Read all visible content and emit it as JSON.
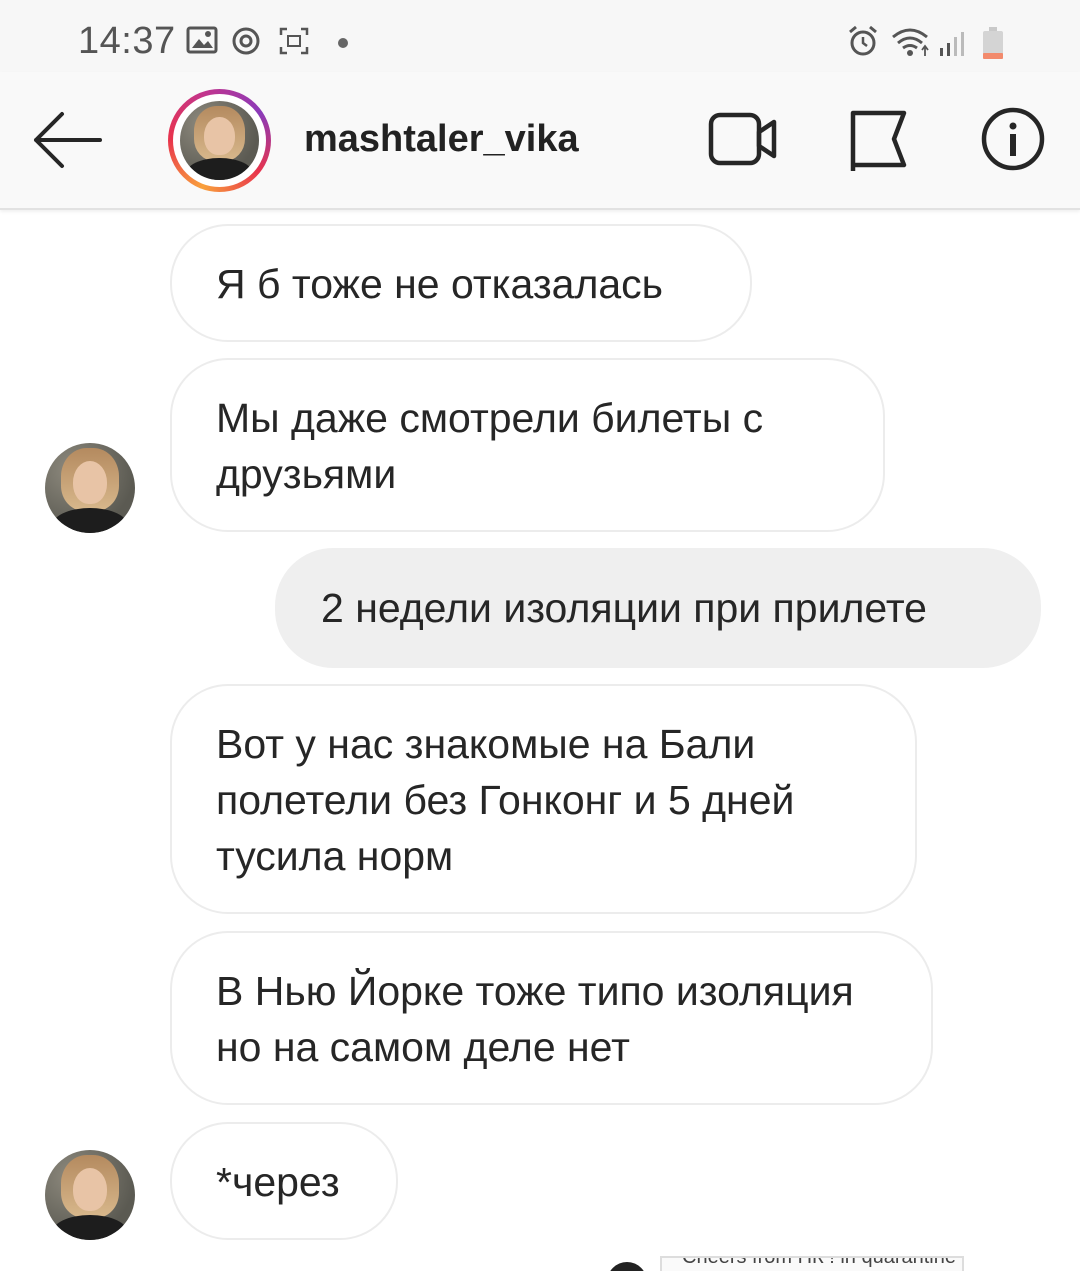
{
  "status_bar": {
    "time": "14:37",
    "left_icons": [
      "image-icon",
      "sync-icon",
      "screenshot-icon",
      "notification-dot"
    ],
    "right_icons": [
      "alarm-icon",
      "wifi-icon",
      "signal-icon",
      "battery-icon"
    ]
  },
  "header": {
    "back_icon": "arrow-left-icon",
    "username": "mashtaler_vika",
    "actions": [
      "video-call-icon",
      "flag-icon",
      "info-icon"
    ]
  },
  "messages": [
    {
      "direction": "incoming",
      "text": "Я б тоже не отказалась",
      "avatar": false
    },
    {
      "direction": "incoming",
      "text": "Мы даже смотрели билеты с друзьями",
      "avatar": true
    },
    {
      "direction": "outgoing",
      "text": "2 недели изоляции при прилете",
      "avatar": false
    },
    {
      "direction": "incoming",
      "text": "Вот у нас знакомые на Бали полетели без Гонконг и 5 дней тусила норм",
      "avatar": false
    },
    {
      "direction": "incoming",
      "text": "В Нью Йорке тоже типо изоляция но на самом деле нет",
      "avatar": false
    },
    {
      "direction": "incoming",
      "text": "*через",
      "avatar": true
    }
  ],
  "attachment_preview": {
    "text": "Cheers from НК ! in quarantine"
  },
  "colors": {
    "outgoing_bubble": "#efefef",
    "incoming_border": "#ececec",
    "story_ring_start": "#f9a13c",
    "story_ring_end": "#c1358f"
  }
}
